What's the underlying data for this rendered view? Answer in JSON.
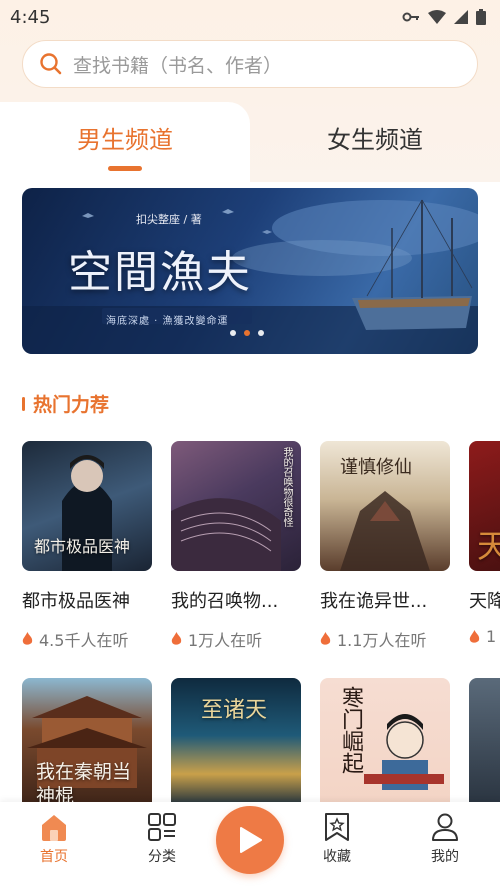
{
  "status_bar": {
    "time": "4:45"
  },
  "search": {
    "placeholder": "查找书籍（书名、作者）"
  },
  "tabs": [
    {
      "label": "男生频道",
      "active": true
    },
    {
      "label": "女生频道",
      "active": false
    }
  ],
  "banner": {
    "title": "空間漁夫",
    "author": "扣尖整座 / 著",
    "subtitle": "海底深處 · 漁獲改變命運",
    "dots": 3,
    "active_dot": 1
  },
  "section": {
    "title": "热门力荐"
  },
  "books_row1": [
    {
      "title": "都市极品医神",
      "listeners": "4.5千人在听",
      "cover_text": "都市极品医神"
    },
    {
      "title": "我的召唤物...",
      "listeners": "1万人在听",
      "cover_text": "我的召唤物很奇怪"
    },
    {
      "title": "我在诡异世...",
      "listeners": "1.1万人在听",
      "cover_text": "谨慎修仙"
    },
    {
      "title": "天降",
      "listeners": "1",
      "cover_text": "天"
    }
  ],
  "books_row2": [
    {
      "cover_text": "我在秦朝当神棍"
    },
    {
      "cover_text": "至诸天"
    },
    {
      "cover_text": "寒门崛起"
    },
    {
      "cover_text": ""
    }
  ],
  "bottom_nav": [
    {
      "label": "首页",
      "icon": "home-icon",
      "active": true
    },
    {
      "label": "分类",
      "icon": "category-icon",
      "active": false
    },
    {
      "label": "收藏",
      "icon": "bookmark-star-icon",
      "active": false
    },
    {
      "label": "我的",
      "icon": "user-icon",
      "active": false
    }
  ],
  "colors": {
    "accent": "#e8732f",
    "play": "#ee7a45"
  }
}
